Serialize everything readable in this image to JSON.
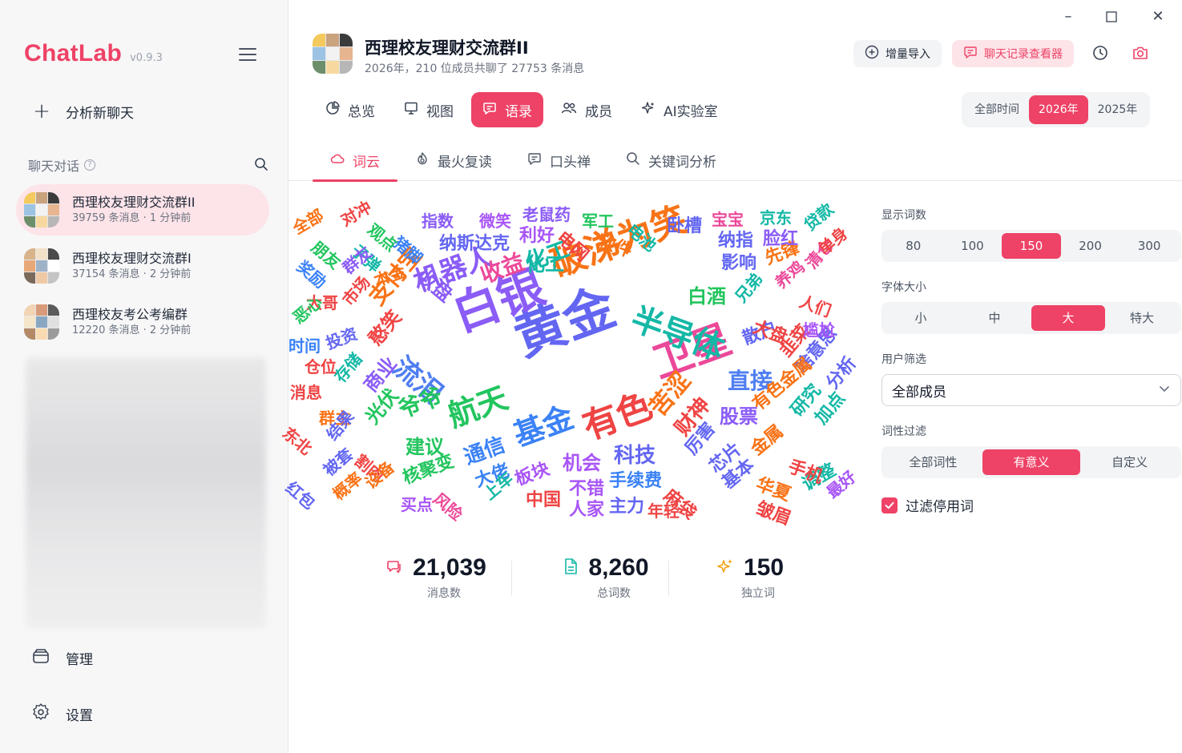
{
  "app": {
    "name": "ChatLab",
    "version": "v0.9.3"
  },
  "sidebar": {
    "new_chat": "分析新聊天",
    "section_title": "聊天对话",
    "chats": [
      {
        "name": "西理校友理财交流群II",
        "sub": "39759 条消息 · 1 分钟前",
        "active": true
      },
      {
        "name": "西理校友理财交流群I",
        "sub": "37154 条消息 · 2 分钟前",
        "active": false
      },
      {
        "name": "西理校友考公考编群",
        "sub": "12220 条消息 · 2 分钟前",
        "active": false
      }
    ],
    "manage": "管理",
    "settings": "设置"
  },
  "header": {
    "title": "西理校友理财交流群II",
    "subtitle": "2026年，210 位成员共聊了 27753 条消息",
    "import_button": "增量导入",
    "viewer_button": "聊天记录查看器"
  },
  "main_tabs": [
    {
      "label": "总览",
      "icon": "pie-chart-icon",
      "active": false
    },
    {
      "label": "视图",
      "icon": "presentation-icon",
      "active": false
    },
    {
      "label": "语录",
      "icon": "chat-bubble-icon",
      "active": true
    },
    {
      "label": "成员",
      "icon": "users-icon",
      "active": false
    },
    {
      "label": "AI实验室",
      "icon": "sparkle-icon",
      "active": false
    }
  ],
  "years": [
    {
      "label": "全部时间",
      "active": false
    },
    {
      "label": "2026年",
      "active": true
    },
    {
      "label": "2025年",
      "active": false
    }
  ],
  "sub_tabs": [
    {
      "label": "词云",
      "icon": "cloud-icon",
      "active": true
    },
    {
      "label": "最火复读",
      "icon": "fire-icon",
      "active": false
    },
    {
      "label": "口头禅",
      "icon": "message-icon",
      "active": false
    },
    {
      "label": "关键词分析",
      "icon": "search-icon",
      "active": false
    }
  ],
  "wordcloud": {
    "colors": {
      "blue": "#4f7ef0",
      "violet": "#8b5cf6",
      "pink": "#ec4899",
      "red": "#ef4444",
      "orange": "#f97316",
      "green": "#22c55e",
      "teal": "#14b8a6",
      "indigo": "#6366f1",
      "purple": "#a855f7",
      "sky": "#3b82f6"
    },
    "words": [
      {
        "text": "黄金",
        "color": "indigo"
      },
      {
        "text": "白银",
        "color": "violet"
      },
      {
        "text": "破涕为笑",
        "color": "orange"
      },
      {
        "text": "卫星",
        "color": "pink"
      },
      {
        "text": "半导体",
        "color": "teal"
      },
      {
        "text": "有色",
        "color": "red"
      },
      {
        "text": "航天",
        "color": "green"
      },
      {
        "text": "机器人",
        "color": "violet"
      },
      {
        "text": "基金",
        "color": "sky"
      },
      {
        "text": "流泪",
        "color": "blue"
      },
      {
        "text": "收益",
        "color": "pink"
      },
      {
        "text": "化工",
        "color": "teal"
      },
      {
        "text": "苦涩",
        "color": "orange"
      },
      {
        "text": "直接",
        "color": "blue"
      },
      {
        "text": "白酒",
        "color": "green"
      },
      {
        "text": "财神",
        "color": "red"
      },
      {
        "text": "科技",
        "color": "indigo"
      },
      {
        "text": "股票",
        "color": "violet"
      },
      {
        "text": "通信",
        "color": "sky"
      },
      {
        "text": "机会",
        "color": "purple"
      },
      {
        "text": "爷爷",
        "color": "green"
      },
      {
        "text": "支付宝",
        "color": "orange"
      },
      {
        "text": "纳斯达克",
        "color": "indigo"
      },
      {
        "text": "收盘",
        "color": "violet"
      },
      {
        "text": "利好",
        "color": "purple"
      },
      {
        "text": "软件",
        "color": "orange"
      },
      {
        "text": "电网",
        "color": "red"
      },
      {
        "text": "化工",
        "color": "teal"
      },
      {
        "text": "憨笑",
        "color": "red"
      },
      {
        "text": "商业",
        "color": "violet"
      },
      {
        "text": "建议",
        "color": "green"
      },
      {
        "text": "光伏",
        "color": "green"
      },
      {
        "text": "大佬",
        "color": "sky"
      },
      {
        "text": "板块",
        "color": "purple"
      },
      {
        "text": "不错",
        "color": "purple"
      },
      {
        "text": "手续费",
        "color": "sky"
      },
      {
        "text": "核聚变",
        "color": "green"
      },
      {
        "text": "中国",
        "color": "red"
      },
      {
        "text": "人家",
        "color": "purple"
      },
      {
        "text": "主力",
        "color": "indigo"
      },
      {
        "text": "年轻",
        "color": "red"
      },
      {
        "text": "麻袋",
        "color": "red"
      },
      {
        "text": "基本",
        "color": "indigo"
      },
      {
        "text": "皱眉",
        "color": "red"
      },
      {
        "text": "最好",
        "color": "purple"
      },
      {
        "text": "调整",
        "color": "teal"
      },
      {
        "text": "华夏",
        "color": "orange"
      },
      {
        "text": "手机",
        "color": "red"
      },
      {
        "text": "加点",
        "color": "teal"
      },
      {
        "text": "研究",
        "color": "teal"
      },
      {
        "text": "分析",
        "color": "indigo"
      },
      {
        "text": "啥意思",
        "color": "indigo"
      },
      {
        "text": "韭菜",
        "color": "red"
      },
      {
        "text": "有色金属",
        "color": "orange"
      },
      {
        "text": "金属",
        "color": "orange"
      },
      {
        "text": "芯片",
        "color": "indigo"
      },
      {
        "text": "厉害",
        "color": "indigo"
      },
      {
        "text": "散户",
        "color": "indigo"
      },
      {
        "text": "大盘",
        "color": "red"
      },
      {
        "text": "尴尬",
        "color": "purple"
      },
      {
        "text": "人们",
        "color": "red"
      },
      {
        "text": "养鸡",
        "color": "pink"
      },
      {
        "text": "兄弟",
        "color": "teal"
      },
      {
        "text": "影响",
        "color": "indigo"
      },
      {
        "text": "先锋",
        "color": "orange"
      },
      {
        "text": "清仓",
        "color": "pink"
      },
      {
        "text": "单身",
        "color": "red"
      },
      {
        "text": "贷款",
        "color": "teal"
      },
      {
        "text": "脸红",
        "color": "violet"
      },
      {
        "text": "京东",
        "color": "teal"
      },
      {
        "text": "纳指",
        "color": "indigo"
      },
      {
        "text": "宝宝",
        "color": "pink"
      },
      {
        "text": "卧槽",
        "color": "indigo"
      },
      {
        "text": "电池",
        "color": "teal"
      },
      {
        "text": "军工",
        "color": "green"
      },
      {
        "text": "老鼠药",
        "color": "violet"
      },
      {
        "text": "微笑",
        "color": "purple"
      },
      {
        "text": "指数",
        "color": "violet"
      },
      {
        "text": "猪脚",
        "color": "sky"
      },
      {
        "text": "观点",
        "color": "green"
      },
      {
        "text": "对冲",
        "color": "red"
      },
      {
        "text": "全部",
        "color": "orange"
      },
      {
        "text": "朋友",
        "color": "green"
      },
      {
        "text": "子弹",
        "color": "teal"
      },
      {
        "text": "奖励",
        "color": "sky"
      },
      {
        "text": "群友",
        "color": "violet"
      },
      {
        "text": "本金",
        "color": "orange"
      },
      {
        "text": "市场",
        "color": "red"
      },
      {
        "text": "大哥",
        "color": "red"
      },
      {
        "text": "恶心",
        "color": "green"
      },
      {
        "text": "时间",
        "color": "sky"
      },
      {
        "text": "投资",
        "color": "indigo"
      },
      {
        "text": "仓位",
        "color": "red"
      },
      {
        "text": "存储",
        "color": "teal"
      },
      {
        "text": "消息",
        "color": "red"
      },
      {
        "text": "群主",
        "color": "orange"
      },
      {
        "text": "东北",
        "color": "red"
      },
      {
        "text": "结果",
        "color": "indigo"
      },
      {
        "text": "割肉",
        "color": "red"
      },
      {
        "text": "红包",
        "color": "indigo"
      },
      {
        "text": "被套",
        "color": "indigo"
      },
      {
        "text": "设备",
        "color": "orange"
      },
      {
        "text": "概率",
        "color": "orange"
      },
      {
        "text": "买点",
        "color": "purple"
      },
      {
        "text": "风险",
        "color": "pink"
      },
      {
        "text": "上车",
        "color": "teal"
      }
    ]
  },
  "stats": [
    {
      "value": "21,039",
      "label": "消息数",
      "icon": "messages-icon"
    },
    {
      "value": "8,260",
      "label": "总词数",
      "icon": "document-icon"
    },
    {
      "value": "150",
      "label": "独立词",
      "icon": "sparkle-icon"
    }
  ],
  "panel": {
    "word_count": {
      "label": "显示词数",
      "options": [
        "80",
        "100",
        "150",
        "200",
        "300"
      ],
      "selected": "150"
    },
    "font_size": {
      "label": "字体大小",
      "options": [
        "小",
        "中",
        "大",
        "特大"
      ],
      "selected": "大"
    },
    "user_filter": {
      "label": "用户筛选",
      "value": "全部成员"
    },
    "pos_filter": {
      "label": "词性过滤",
      "options": [
        "全部词性",
        "有意义",
        "自定义"
      ],
      "selected": "有意义"
    },
    "stopwords": {
      "label": "过滤停用词",
      "checked": true
    }
  },
  "accent_color": "#ee4266"
}
